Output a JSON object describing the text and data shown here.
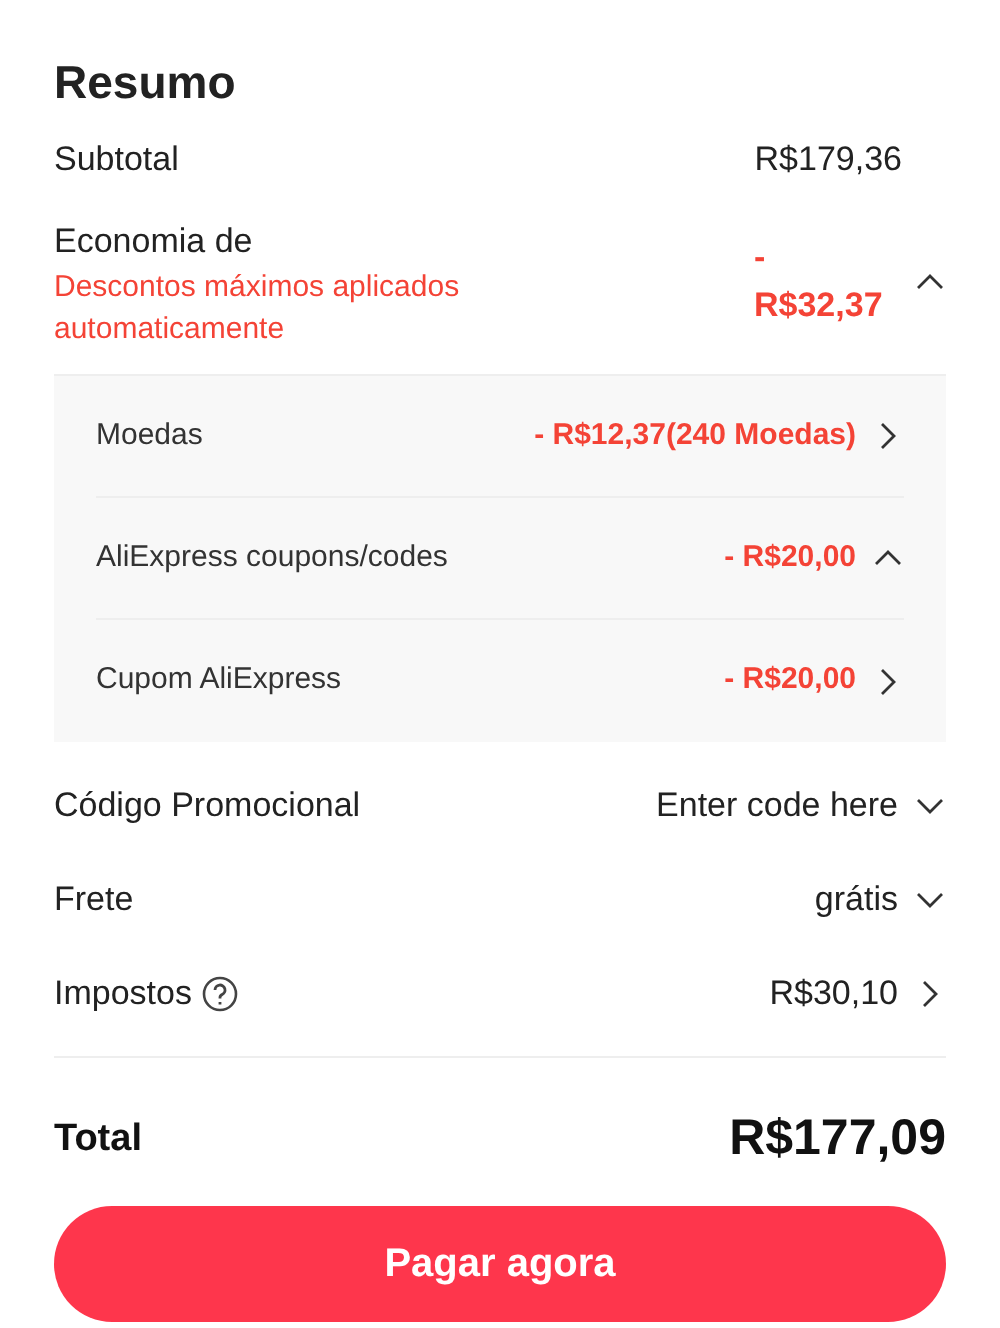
{
  "title": "Resumo",
  "subtotal": {
    "label": "Subtotal",
    "value": "R$179,36"
  },
  "savings": {
    "label": "Economia de",
    "note": "Descontos máximos aplicados automaticamente",
    "value": "- R$32,37",
    "expanded": true,
    "items": [
      {
        "label": "Moedas",
        "value": "- R$12,37(240 Moedas)",
        "kind": "link"
      },
      {
        "label": "AliExpress coupons/codes",
        "value": "- R$20,00",
        "kind": "expanded"
      },
      {
        "label": "Cupom AliExpress",
        "value": "- R$20,00",
        "kind": "link"
      }
    ]
  },
  "rows": [
    {
      "label": "Código Promocional",
      "value": "Enter code here",
      "kind": "dropdown",
      "help": false
    },
    {
      "label": "Frete",
      "value": "grátis",
      "kind": "dropdown",
      "help": false
    },
    {
      "label": "Impostos",
      "value": "R$30,10",
      "kind": "link",
      "help": true
    }
  ],
  "total": {
    "label": "Total",
    "value": "R$177,09"
  },
  "button": "Pagar agora"
}
